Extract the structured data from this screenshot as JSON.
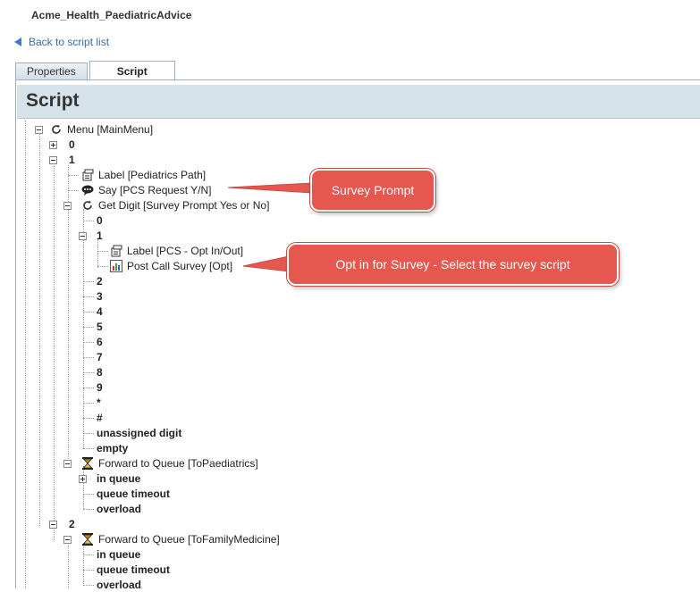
{
  "app": {
    "title": "Acme_Health_PaediatricAdvice"
  },
  "nav": {
    "back_label": "Back to script list"
  },
  "tabs": [
    {
      "label": "Properties"
    },
    {
      "label": "Script"
    }
  ],
  "script_header": "Script",
  "tree": {
    "menu": "Menu [MainMenu]",
    "opt0": "0",
    "opt1": "1",
    "label_ped": "Label [Pediatrics Path]",
    "say": "Say [PCS Request Y/N]",
    "getdigit": "Get Digit [Survey Prompt Yes or No]",
    "gd": [
      "0",
      "1",
      "2",
      "3",
      "4",
      "5",
      "6",
      "7",
      "8",
      "9",
      "*",
      "#",
      "unassigned digit",
      "empty"
    ],
    "label_pcs": "Label [PCS - Opt In/Out]",
    "pcs": "Post Call Survey [Opt]",
    "fwd1": "Forward to Queue [ToPaediatrics]",
    "fwd1_children": [
      "in queue",
      "queue timeout",
      "overload"
    ],
    "opt2": "2",
    "fwd2": "Forward to Queue [ToFamilyMedicine]",
    "fwd2_children": [
      "in queue",
      "queue timeout",
      "overload"
    ]
  },
  "callouts": {
    "survey_prompt": "Survey Prompt",
    "opt_in": "Opt in for Survey -  Select the survey script"
  },
  "colors": {
    "callout": "#e6584f",
    "header_bg": "#d6e3ea",
    "link": "#3a6ea5"
  }
}
